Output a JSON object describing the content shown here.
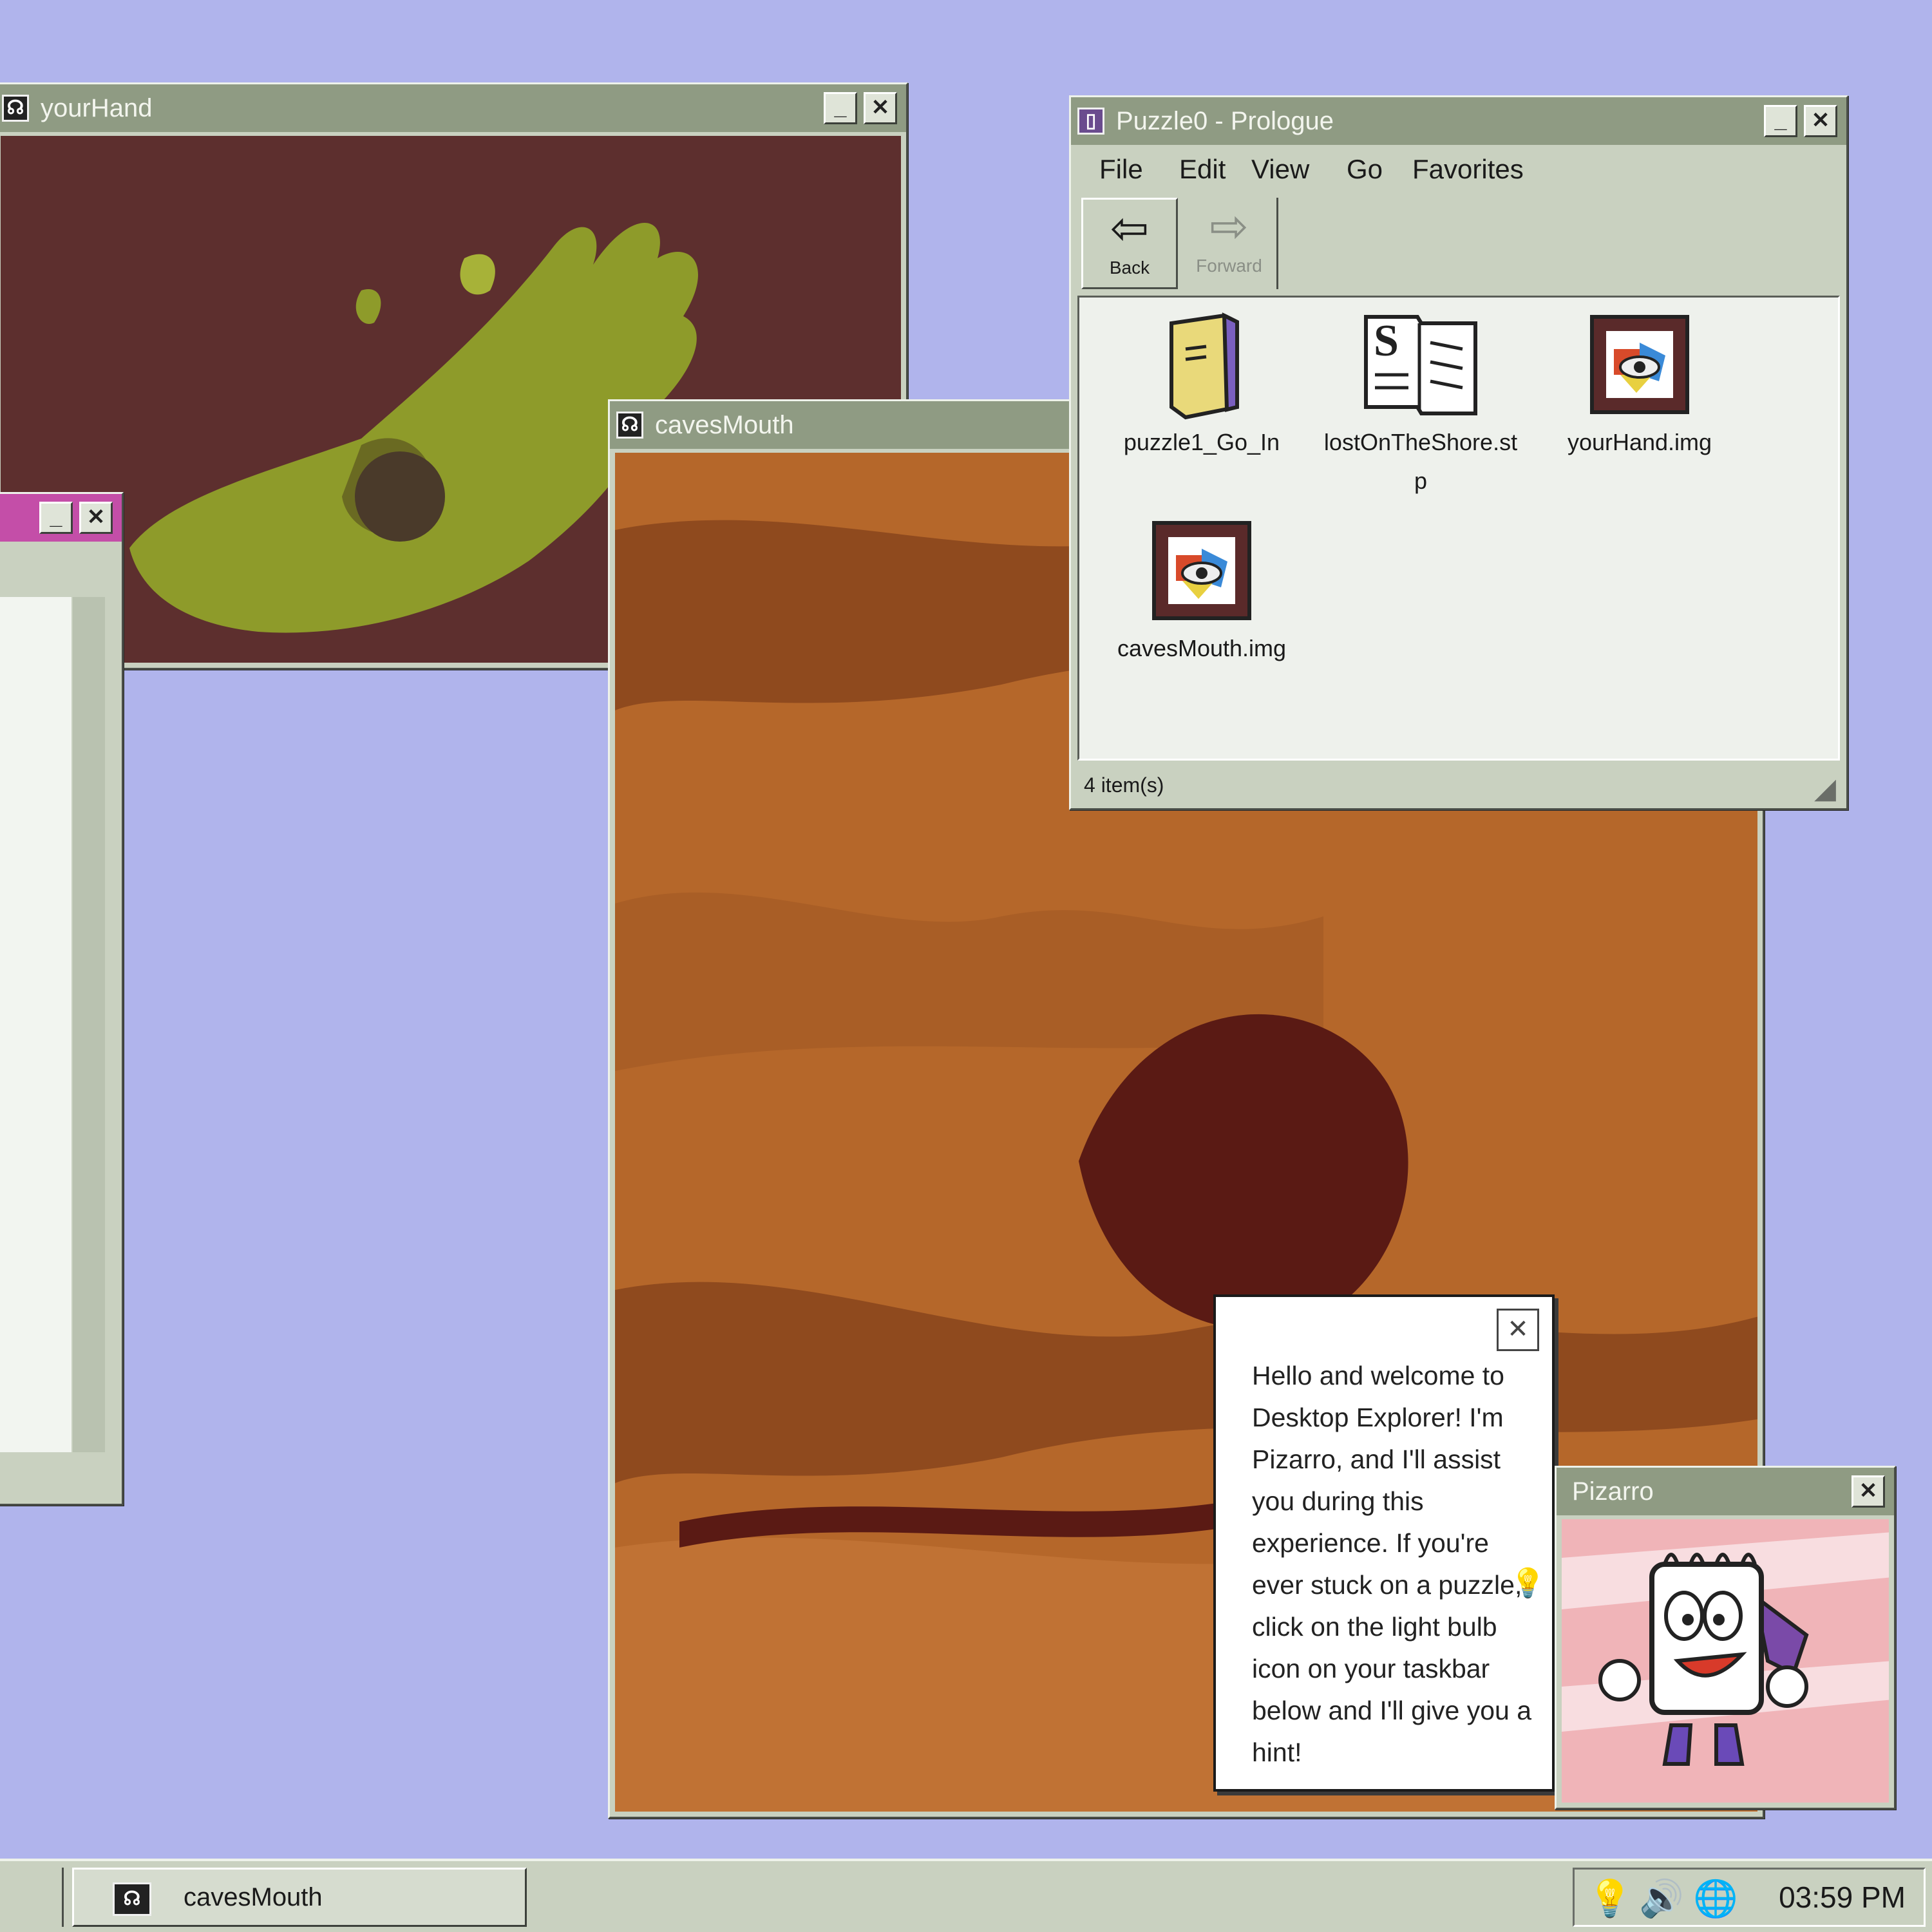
{
  "windows": {
    "your_hand": {
      "title": "yourHand"
    },
    "caves_mouth": {
      "title": "cavesMouth"
    },
    "explorer": {
      "title": "Puzzle0 - Prologue",
      "menu": [
        "File",
        "Edit",
        "View",
        "Go",
        "Favorites"
      ],
      "toolbar": {
        "back": "Back",
        "forward": "Forward"
      },
      "files": [
        {
          "name": "puzzle1_Go_In",
          "icon": "folder-icon"
        },
        {
          "name": "lostOnTheShore.stp",
          "icon": "document-icon"
        },
        {
          "name": "yourHand.img",
          "icon": "image-file-icon"
        },
        {
          "name": "cavesMouth.img",
          "icon": "image-file-icon"
        }
      ],
      "status": "4 item(s)"
    },
    "pizarro": {
      "title": "Pizarro"
    }
  },
  "balloon": {
    "text": "Hello and welcome to Desktop Explorer! I'm Pizarro, and I'll assist you during this experience. If you're ever stuck on a puzzle, click on the light bulb icon on your taskbar below and I'll give you a hint!"
  },
  "taskbar": {
    "active_task": "cavesMouth",
    "clock": "03:59 PM"
  },
  "colors": {
    "desktop": "#b0b4ec",
    "title_inactive": "#8f9b83",
    "hand_bg": "#5d2f2e",
    "hand_fg": "#8e9b2a",
    "cave_bg": "#b5672a",
    "cave_dark": "#5a1a14"
  }
}
